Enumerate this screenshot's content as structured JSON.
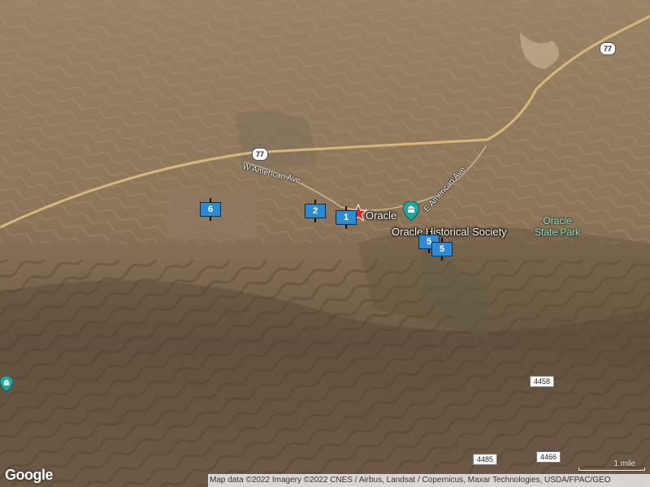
{
  "map": {
    "type": "satellite",
    "roads": {
      "w_american_ave": "W American Ave",
      "e_american_ave": "E American Ave",
      "hwy_77_a": "77",
      "hwy_77_b": "77",
      "route_4458": "4458",
      "route_4485": "4485",
      "route_4466": "4466"
    },
    "places": {
      "oracle": "Oracle",
      "historical_society": "Oracle Historical Society",
      "state_park_line1": "Oracle",
      "state_park_line2": "State Park"
    },
    "markers": [
      {
        "label": "1"
      },
      {
        "label": "2"
      },
      {
        "label": "5"
      },
      {
        "label": "5"
      },
      {
        "label": "6"
      }
    ],
    "colors": {
      "marker_fill": "#2b8bd4",
      "star": "#e0242b",
      "poi_pin": "#1fa8a0",
      "park_label": "#9be3b4"
    }
  },
  "footer": {
    "logo": "Google",
    "attribution": "Map data ©2022 Imagery ©2022 CNES / Airbus, Landsat / Copernicus, Maxar Technologies, USDA/FPAC/GEO",
    "scale_label": "1 mile"
  }
}
